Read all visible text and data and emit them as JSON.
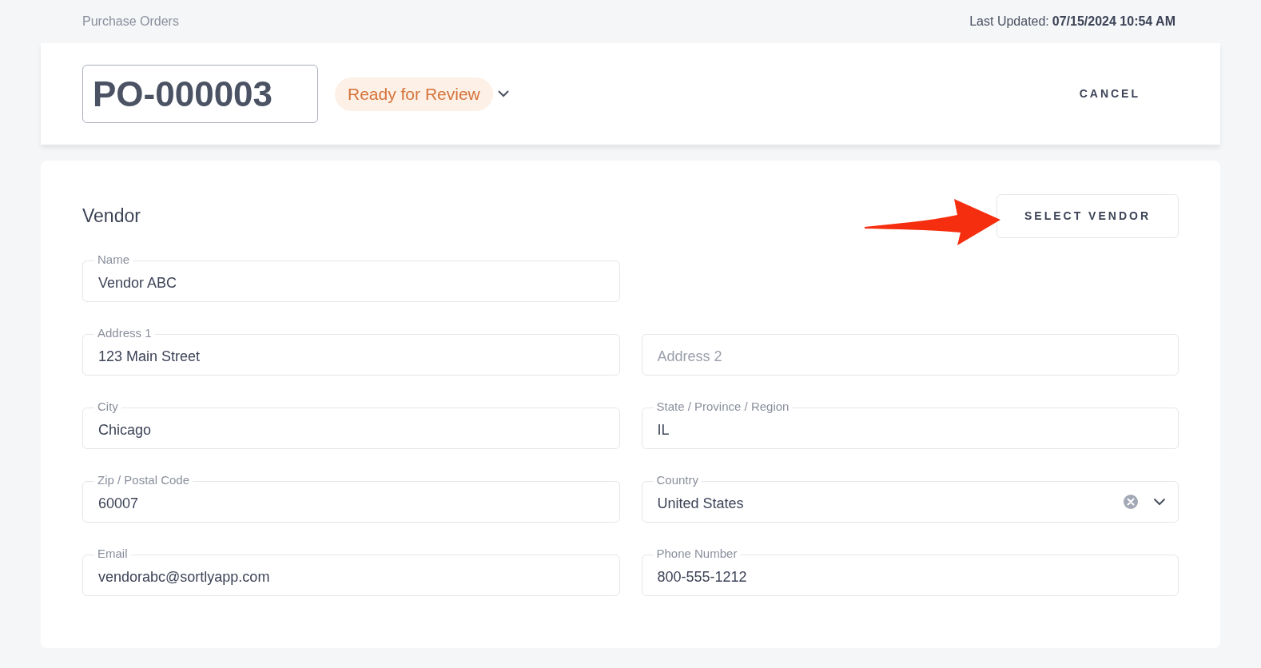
{
  "breadcrumb": "Purchase Orders",
  "last_updated": {
    "label": "Last Updated:",
    "value": "07/15/2024 10:54 AM"
  },
  "header": {
    "po_number": "PO-000003",
    "status": "Ready for Review",
    "cancel": "CANCEL"
  },
  "vendor": {
    "title": "Vendor",
    "select_button": "SELECT VENDOR",
    "rows": [
      [
        {
          "kind": "text",
          "label": "Name",
          "value": "Vendor ABC"
        }
      ],
      [
        {
          "kind": "text",
          "label": "Address 1",
          "value": "123 Main Street"
        },
        {
          "kind": "text",
          "placeholder": "Address 2"
        }
      ],
      [
        {
          "kind": "text",
          "label": "City",
          "value": "Chicago"
        },
        {
          "kind": "text",
          "label": "State / Province / Region",
          "value": "IL"
        }
      ],
      [
        {
          "kind": "text",
          "label": "Zip / Postal Code",
          "value": "60007"
        },
        {
          "kind": "select",
          "label": "Country",
          "value": "United States"
        }
      ],
      [
        {
          "kind": "text",
          "label": "Email",
          "value": "vendorabc@sortlyapp.com"
        },
        {
          "kind": "text",
          "label": "Phone Number",
          "value": "800-555-1212"
        }
      ]
    ]
  }
}
